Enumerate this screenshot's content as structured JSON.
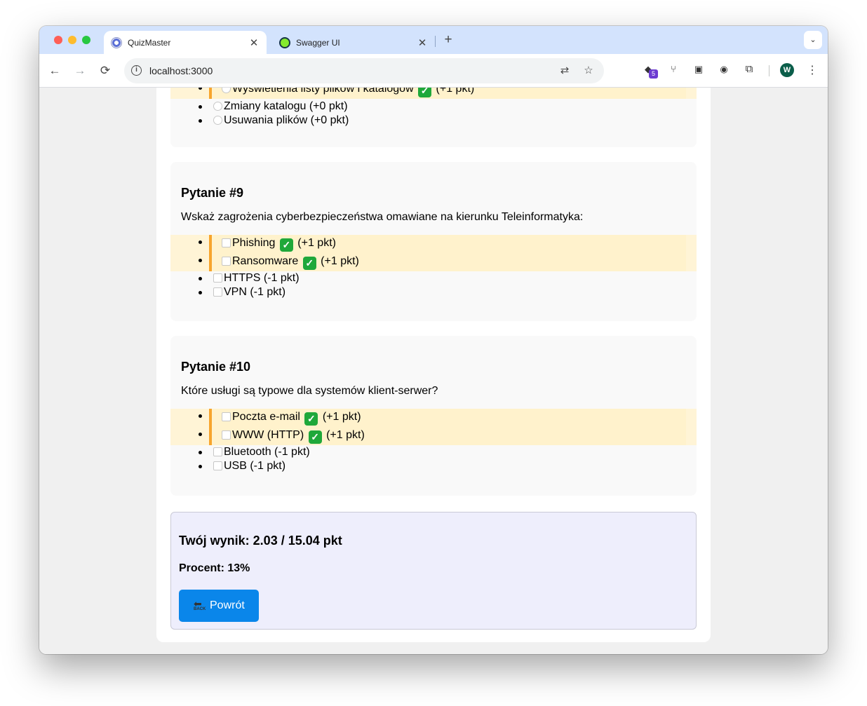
{
  "browser": {
    "tabs": [
      {
        "title": "QuizMaster",
        "active": true
      },
      {
        "title": "Swagger UI",
        "active": false
      }
    ],
    "url": "localhost:3000",
    "profile_initial": "W",
    "extension_badge": "5",
    "icons": {
      "back": "←",
      "forward": "→",
      "reload": "⟳",
      "close": "✕",
      "new_tab": "+",
      "tab_search": "⌄",
      "info": "i",
      "translate": "⇄",
      "star": "☆",
      "menu": "⋮",
      "extensions": "⧉"
    }
  },
  "quiz": {
    "q8": {
      "answers": [
        {
          "text": "Wyświetlenia listy plików i katalogów",
          "points": "(+1 pkt)",
          "correct": true
        },
        {
          "text": "Zmiany katalogu (+0 pkt)",
          "correct": false
        },
        {
          "text": "Usuwania plików (+0 pkt)",
          "correct": false
        }
      ]
    },
    "q9": {
      "title": "Pytanie #9",
      "text": "Wskaż zagrożenia cyberbezpieczeństwa omawiane na kierunku Teleinformatyka:",
      "answers": [
        {
          "text": "Phishing",
          "points": "(+1 pkt)",
          "correct": true
        },
        {
          "text": "Ransomware",
          "points": "(+1 pkt)",
          "correct": true
        },
        {
          "text": "HTTPS (-1 pkt)",
          "correct": false
        },
        {
          "text": "VPN (-1 pkt)",
          "correct": false
        }
      ]
    },
    "q10": {
      "title": "Pytanie #10",
      "text": "Które usługi są typowe dla systemów klient-serwer?",
      "answers": [
        {
          "text": "Poczta e-mail",
          "points": "(+1 pkt)",
          "correct": true
        },
        {
          "text": "WWW (HTTP)",
          "points": "(+1 pkt)",
          "correct": true
        },
        {
          "text": "Bluetooth (-1 pkt)",
          "correct": false
        },
        {
          "text": "USB (-1 pkt)",
          "correct": false
        }
      ]
    },
    "check_mark": "✓"
  },
  "result": {
    "score": "Twój wynik: 2.03 / 15.04 pkt",
    "percent": "Procent: 13%",
    "back_button": "Powrót",
    "back_icon_label": "BACK"
  },
  "colors": {
    "highlight_bg": "#fff2cc",
    "highlight_bar": "#f7a52d",
    "check_green": "#1fa83a",
    "button_blue": "#0a86ea",
    "result_bg": "#eeeefc"
  }
}
